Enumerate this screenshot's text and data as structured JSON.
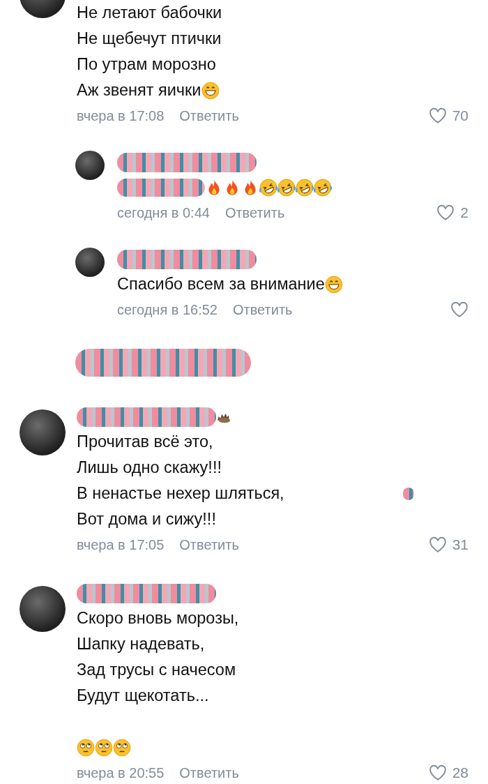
{
  "comments": [
    {
      "lines": [
        [
          {
            "kind": "text",
            "text": "Не летают бабочки"
          }
        ],
        [
          {
            "kind": "text",
            "text": "Не щебечут птички"
          }
        ],
        [
          {
            "kind": "text",
            "text": "По утрам морозно"
          }
        ],
        [
          {
            "kind": "text",
            "text": "Аж звенят яички"
          },
          {
            "kind": "grin"
          }
        ]
      ],
      "time": "вчера в 17:08",
      "reply": "Ответить",
      "likes": "70",
      "liked": false,
      "replies": [
        {
          "name": [
            {
              "kind": "redaction"
            }
          ],
          "lines": [
            [
              {
                "kind": "redaction"
              },
              {
                "kind": "fire"
              },
              {
                "kind": "fire"
              },
              {
                "kind": "fire"
              },
              {
                "kind": "rofl"
              },
              {
                "kind": "rofl"
              },
              {
                "kind": "rofl"
              },
              {
                "kind": "rofl"
              }
            ]
          ],
          "time": "сегодня в 0:44",
          "reply": "Ответить",
          "likes": "2",
          "liked": false
        },
        {
          "name": [
            {
              "kind": "redaction"
            }
          ],
          "lines": [
            [
              {
                "kind": "text",
                "text": "Спасибо всем за внимание"
              },
              {
                "kind": "grin"
              }
            ]
          ],
          "time": "сегодня в 16:52",
          "reply": "Ответить",
          "liked": false
        }
      ]
    },
    {
      "hidden": true
    },
    {
      "name": [
        {
          "kind": "redaction"
        },
        {
          "kind": "hedgehog"
        }
      ],
      "lines": [
        [
          {
            "kind": "text",
            "text": "Прочитав всё это,"
          }
        ],
        [
          {
            "kind": "text",
            "text": "Лишь одно скажу!!!"
          }
        ],
        [
          {
            "kind": "text",
            "text": "В ненастье нехер шляться,"
          },
          {
            "kind": "dot"
          }
        ],
        [
          {
            "kind": "text",
            "text": "Вот дома и сижу!!!"
          }
        ]
      ],
      "time": "вчера в 17:05",
      "reply": "Ответить",
      "likes": "31",
      "liked": false
    },
    {
      "name": [
        {
          "kind": "redaction"
        }
      ],
      "lines": [
        [
          {
            "kind": "text",
            "text": "Скоро вновь морозы,"
          }
        ],
        [
          {
            "kind": "text",
            "text": "Шапку надевать,"
          }
        ],
        [
          {
            "kind": "text",
            "text": "Зад трусы с начесом"
          }
        ],
        [
          {
            "kind": "text",
            "text": "Будут щекотать..."
          }
        ],
        [
          {
            "kind": "spacer"
          },
          {
            "kind": "eyeroll"
          },
          {
            "kind": "eyeroll"
          },
          {
            "kind": "eyeroll"
          }
        ]
      ],
      "time": "вчера в 20:55",
      "reply": "Ответить",
      "likes": "28",
      "liked": false
    }
  ]
}
